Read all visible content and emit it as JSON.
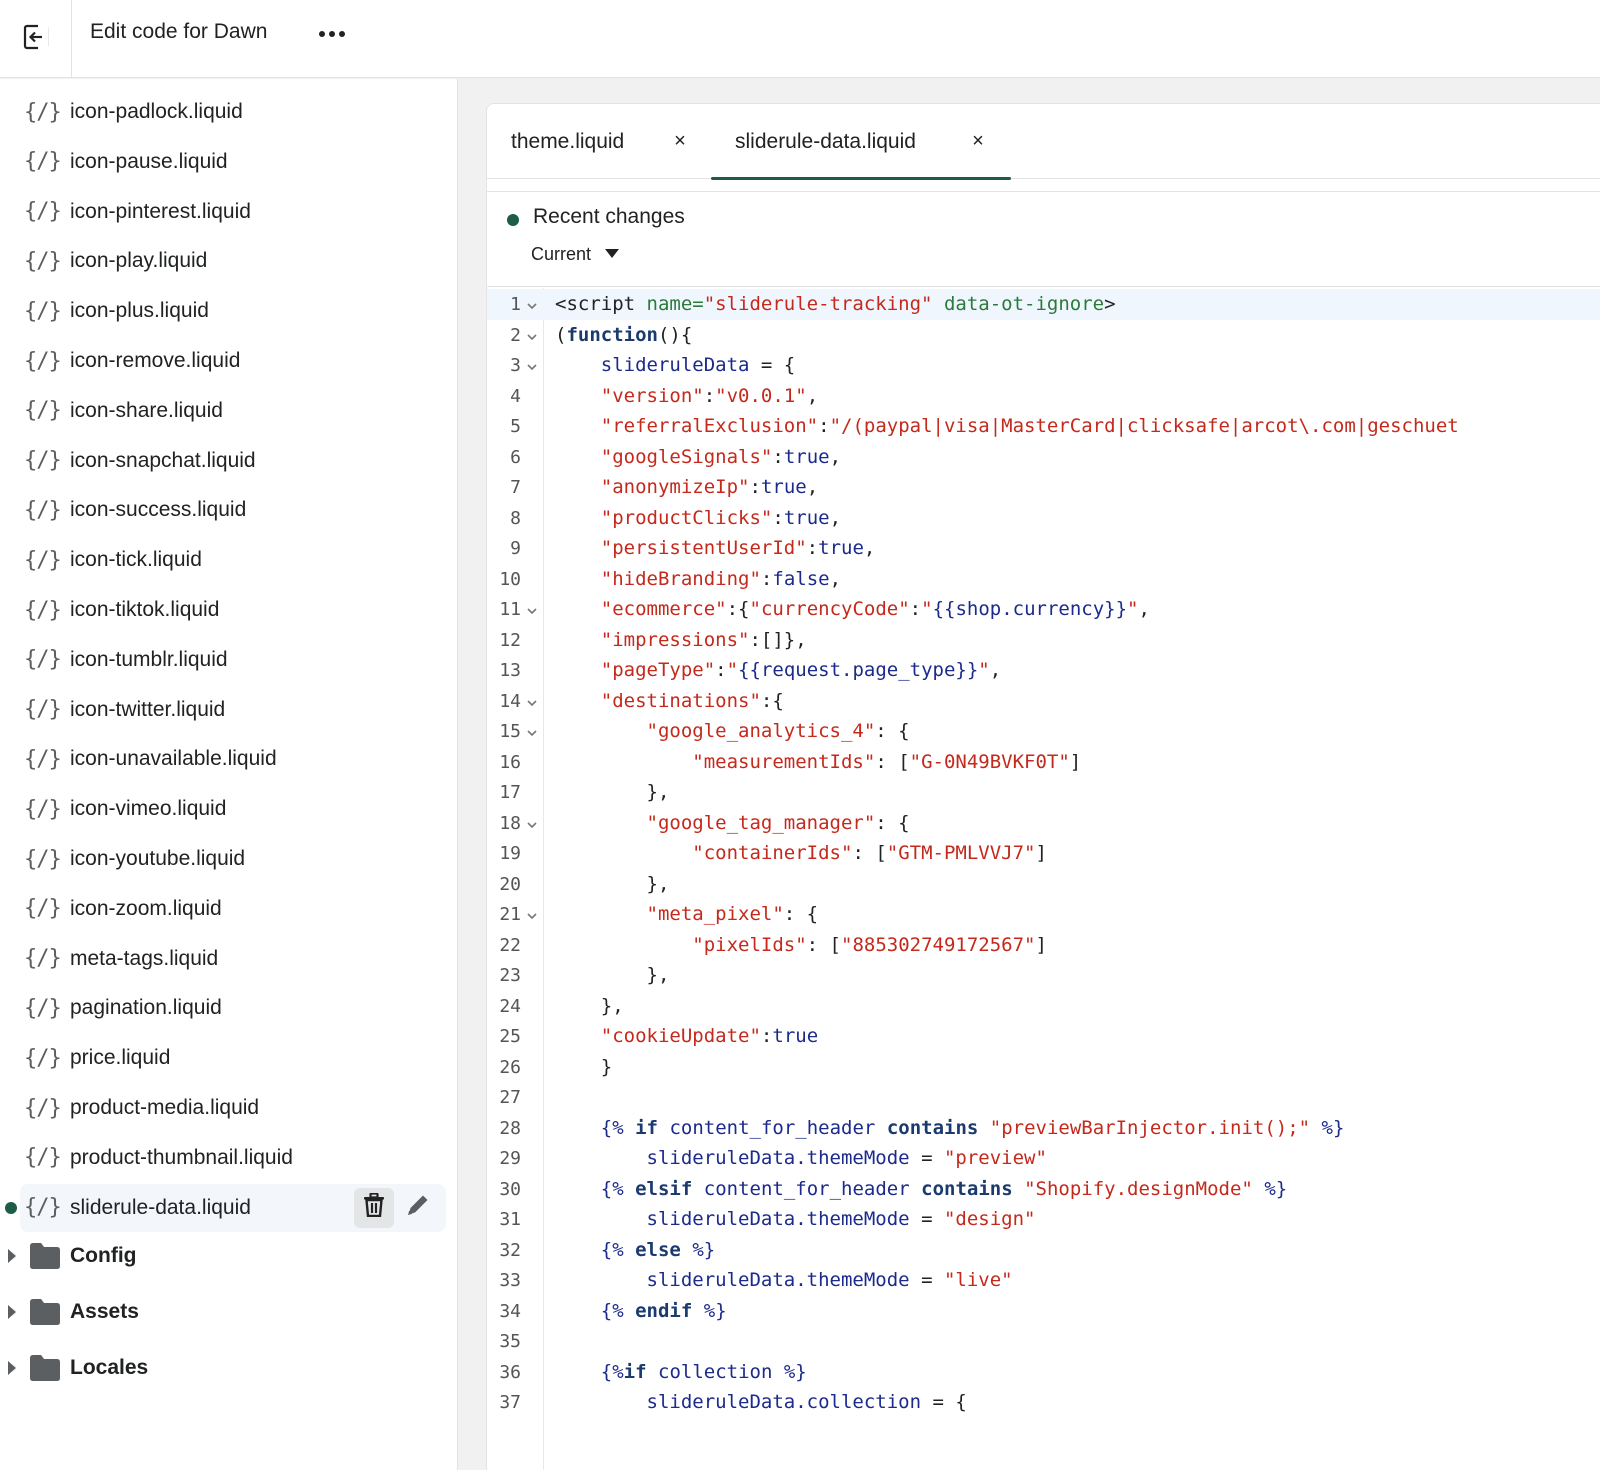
{
  "topbar": {
    "title": "Edit code for Dawn"
  },
  "sidebar": {
    "files": [
      "icon-padlock.liquid",
      "icon-pause.liquid",
      "icon-pinterest.liquid",
      "icon-play.liquid",
      "icon-plus.liquid",
      "icon-remove.liquid",
      "icon-share.liquid",
      "icon-snapchat.liquid",
      "icon-success.liquid",
      "icon-tick.liquid",
      "icon-tiktok.liquid",
      "icon-tumblr.liquid",
      "icon-twitter.liquid",
      "icon-unavailable.liquid",
      "icon-vimeo.liquid",
      "icon-youtube.liquid",
      "icon-zoom.liquid",
      "meta-tags.liquid",
      "pagination.liquid",
      "price.liquid",
      "product-media.liquid",
      "product-thumbnail.liquid",
      "sliderule-data.liquid"
    ],
    "file_icon": "{/}",
    "active_file": "sliderule-data.liquid",
    "folders": [
      "Config",
      "Assets",
      "Locales"
    ]
  },
  "tabs": [
    {
      "label": "theme.liquid",
      "active": false
    },
    {
      "label": "sliderule-data.liquid",
      "active": true
    }
  ],
  "tab_close_glyph": "×",
  "changes": {
    "title": "Recent changes",
    "version": "Current"
  },
  "colors": {
    "accent": "#1d5d45",
    "string": "#c4291c",
    "attr": "#2a7a3a",
    "keyword": "#1b3b6f"
  },
  "code_lines": [
    "<script name=\"sliderule-tracking\" data-ot-ignore>",
    "(function(){",
    "    slideruleData = {",
    "    \"version\":\"v0.0.1\",",
    "    \"referralExclusion\":\"/(paypal|visa|MasterCard|clicksafe|arcot\\.com|geschuet",
    "    \"googleSignals\":true,",
    "    \"anonymizeIp\":true,",
    "    \"productClicks\":true,",
    "    \"persistentUserId\":true,",
    "    \"hideBranding\":false,",
    "    \"ecommerce\":{\"currencyCode\":\"{{shop.currency}}\",",
    "    \"impressions\":[]},",
    "    \"pageType\":\"{{request.page_type}}\",",
    "    \"destinations\":{",
    "        \"google_analytics_4\": {",
    "            \"measurementIds\": [\"G-0N49BVKF0T\"]",
    "        },",
    "        \"google_tag_manager\": {",
    "            \"containerIds\": [\"GTM-PMLVVJ7\"]",
    "        },",
    "        \"meta_pixel\": {",
    "            \"pixelIds\": [\"885302749172567\"]",
    "        },",
    "    },",
    "    \"cookieUpdate\":true",
    "    }",
    "",
    "    {% if content_for_header contains \"previewBarInjector.init();\" %}",
    "        slideruleData.themeMode = \"preview\"",
    "    {% elsif content_for_header contains \"Shopify.designMode\" %}",
    "        slideruleData.themeMode = \"design\"",
    "    {% else %}",
    "        slideruleData.themeMode = \"live\"",
    "    {% endif %}",
    "",
    "    {%if collection %}",
    "        slideruleData.collection = {"
  ],
  "foldable_lines": [
    1,
    2,
    3,
    11,
    14,
    15,
    18,
    21
  ]
}
